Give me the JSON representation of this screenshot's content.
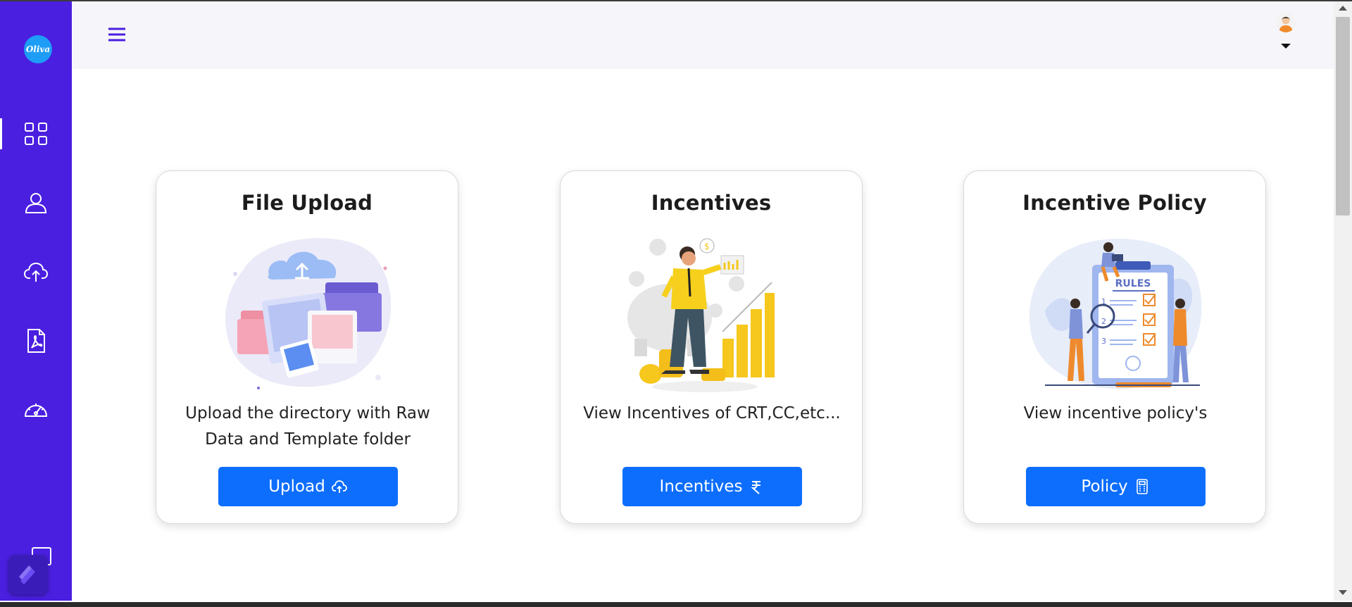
{
  "app": {
    "logo_text": "Oliva"
  },
  "sidebar": {
    "items": [
      {
        "name": "dashboard",
        "icon": "grid-icon",
        "active": true
      },
      {
        "name": "users",
        "icon": "user-icon",
        "active": false
      },
      {
        "name": "upload",
        "icon": "cloud-upload-icon",
        "active": false
      },
      {
        "name": "documents",
        "icon": "pdf-file-icon",
        "active": false
      },
      {
        "name": "performance",
        "icon": "speedometer-icon",
        "active": false
      }
    ],
    "bottom_icon": "logout-icon"
  },
  "header": {
    "menu_icon": "hamburger-icon",
    "profile_icon": "avatar"
  },
  "cards": [
    {
      "title": "File Upload",
      "description": "Upload the directory with Raw Data and Template folder",
      "button_label": "Upload",
      "button_icon": "cloud-upload-icon",
      "illustration": "file-upload-illustration"
    },
    {
      "title": "Incentives",
      "description": "View Incentives of CRT,CC,etc...",
      "button_label": "Incentives",
      "button_icon": "rupee-icon",
      "illustration": "incentives-illustration"
    },
    {
      "title": "Incentive Policy",
      "description": "View incentive policy's",
      "button_label": "Policy",
      "button_icon": "calculator-icon",
      "illustration": "rules-illustration",
      "illustration_text": "RULES"
    }
  ],
  "colors": {
    "sidebar": "#4a1fe0",
    "header": "#f6f6fa",
    "button": "#0d6efd",
    "logo": "#1e9df7"
  }
}
